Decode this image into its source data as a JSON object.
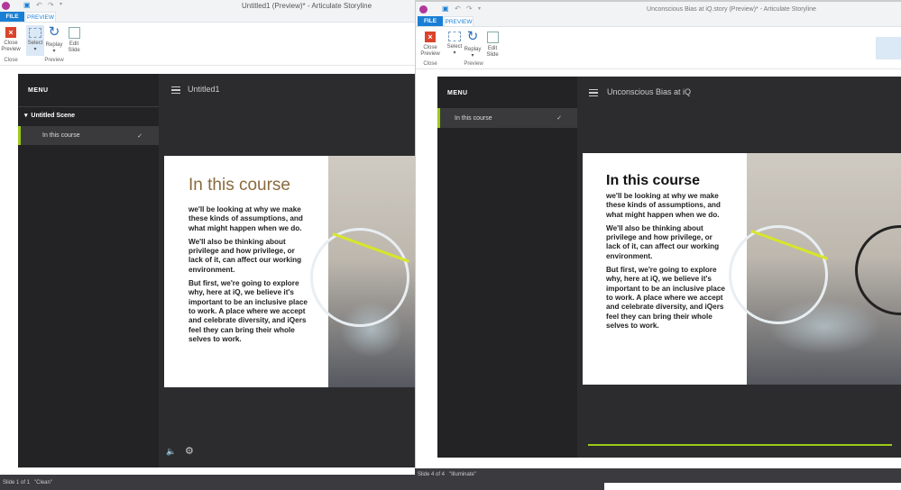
{
  "left_window": {
    "title": "Untitled1 (Preview)* - Articulate Storyline",
    "logo": "SL",
    "tabs": {
      "file": "FILE",
      "preview": "PREVIEW"
    },
    "ribbon": {
      "close_preview": "Close Preview",
      "close_group": "Close",
      "select": "Select",
      "replay": "Replay",
      "edit_slide": "Edit Slide",
      "preview_group": "Preview",
      "dropdown": "▾"
    },
    "player": {
      "menu": "MENU",
      "scene": "Untitled Scene",
      "item": "In this course",
      "check": "✓",
      "title": "Untitled1"
    },
    "slide": {
      "heading": "In this course",
      "paragraphs": [
        "we'll be looking at why we make these kinds of assumptions, and what might happen when we do.",
        "We'll also be thinking about privilege and how privilege, or lack of it, can affect our working environment.",
        "But first, we're going to explore why, here at iQ, we believe it's important to be an inclusive place to work. A place where we accept and celebrate diversity, and iQers feel they can bring their whole selves to work."
      ]
    },
    "status": "Slide 1 of 1   \"Clean\""
  },
  "right_window": {
    "title": "Unconscious Bias at iQ.story (Preview)* - Articulate Storyline",
    "logo": "SL",
    "tabs": {
      "file": "FILE",
      "preview": "PREVIEW"
    },
    "ribbon": {
      "close_preview": "Close Preview",
      "close_group": "Close",
      "select": "Select",
      "replay": "Replay",
      "edit_slide": "Edit Slide",
      "preview_group": "Preview",
      "dropdown": "▾"
    },
    "player": {
      "menu": "MENU",
      "item": "In this course",
      "check": "✓",
      "title": "Unconscious Bias at iQ",
      "progress": 1.0
    },
    "slide": {
      "heading": "In this course",
      "paragraphs": [
        "we'll be looking at why we make these kinds of assumptions, and what might happen when we do.",
        "We'll also be thinking about privilege and how privilege, or lack of it, can affect our working environment.",
        "But first, we're going to explore why, here at iQ, we believe it's important to be an inclusive place to work. A place where we accept and celebrate diversity, and iQers feel they can bring their whole selves to work."
      ]
    },
    "status": "Slide 4 of 4   \"Illuminate\""
  },
  "colors": {
    "accent": "#9ccb1a",
    "file_tab": "#1a7fd4",
    "player_bg": "#2c2c2e"
  }
}
